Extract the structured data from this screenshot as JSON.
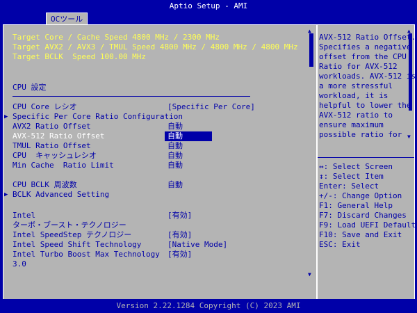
{
  "title": "Aptio Setup - AMI",
  "tab": "OCツール",
  "targets": [
    "Target Core / Cache Speed 4800 MHz / 2300 MHz",
    "Target AVX2 / AVX3 / TMUL Speed 4800 MHz / 4800 MHz / 4800 MHz",
    "Target BCLK  Speed 100.00 MHz"
  ],
  "section_title": "CPU 設定",
  "items": [
    {
      "label": "CPU Core レシオ",
      "value": "[Specific Per Core]"
    },
    {
      "label": "Specific Per Core Ratio Configuration",
      "value": ""
    },
    {
      "label": "AVX2 Ratio Offset",
      "value": "自動"
    },
    {
      "label": "AVX-512 Ratio Offset",
      "value": "自動"
    },
    {
      "label": "TMUL Ratio Offset",
      "value": "自動"
    },
    {
      "label": "CPU  キャッシュレシオ",
      "value": "自動"
    },
    {
      "label": "Min Cache  Ratio Limit",
      "value": "自動"
    },
    {
      "label": "CPU BCLK 周波数",
      "value": "自動"
    },
    {
      "label": "BCLK Advanced Setting",
      "value": ""
    },
    {
      "label": "Intel",
      "value": "[有効]"
    },
    {
      "label": "ターボ・ブースト・テクノロジー",
      "value": ""
    },
    {
      "label": "Intel SpeedStep テクノロジー",
      "value": "[有効]"
    },
    {
      "label": "Intel Speed Shift Technology",
      "value": "[Native Mode]"
    },
    {
      "label": "Intel Turbo Boost Max Technology",
      "value": "[有効]"
    },
    {
      "label": "3.0",
      "value": ""
    }
  ],
  "help_lines": [
    "AVX-512 Ratio Offset.",
    "Specifies a negative",
    "offset from the CPU",
    "Ratio for AVX-512",
    "workloads. AVX-512 is",
    "a more stressful",
    "workload, it is",
    "helpful to lower the",
    "AVX-512 ratio to",
    "ensure maximum",
    "possible ratio for"
  ],
  "key_help": [
    "↔: Select Screen",
    "↕: Select Item",
    "Enter: Select",
    "+/-: Change Option",
    "F1: General Help",
    "F7: Discard Changes",
    "F9: Load UEFI Defaults",
    "F10: Save and Exit",
    "ESC: Exit"
  ],
  "footer": "Version 2.22.1284 Copyright (C) 2023 AMI",
  "icons": {
    "submenu_arrow": "▶",
    "scroll_up": "▲",
    "scroll_down": "▼"
  },
  "colors": {
    "bios_blue": "#0000a8",
    "panel_gray": "#b4b4b4",
    "highlight_yellow": "#ffff55",
    "white": "#ffffff"
  }
}
